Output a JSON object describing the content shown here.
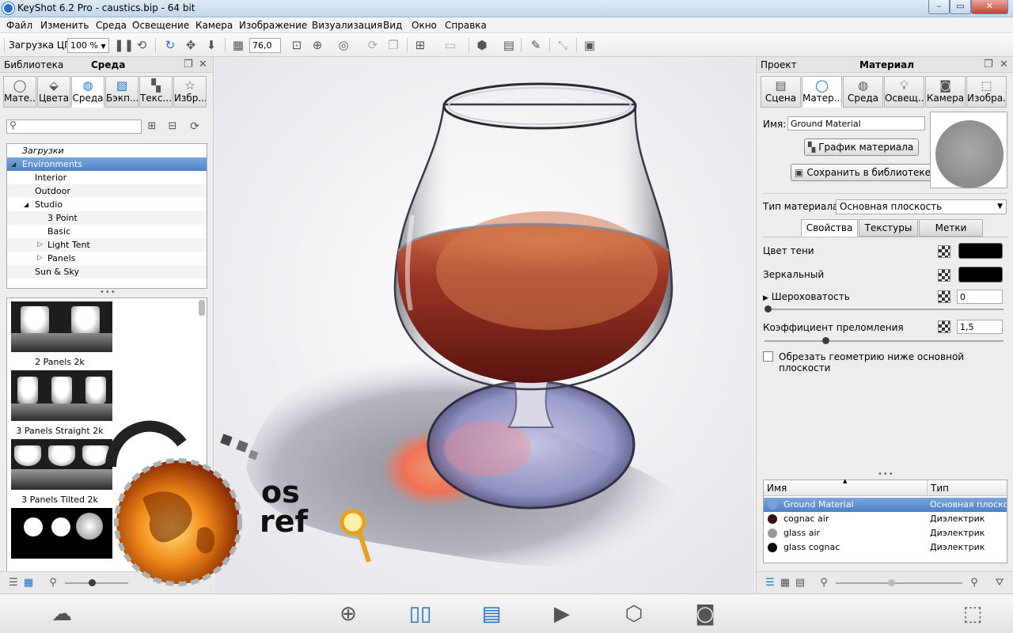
{
  "window": {
    "title": "KeyShot 6.2 Pro  -  caustics.bip  -  64 bit",
    "btn_min": "–",
    "btn_max": "▭",
    "btn_close": "✕"
  },
  "menu": [
    "Файл",
    "Изменить",
    "Среда",
    "Освещение",
    "Камера",
    "Изображение",
    "Визуализация",
    "Вид",
    "Окно",
    "Справка"
  ],
  "toolbar": {
    "cpu_label": "Загрузка ЦП",
    "cpu_value": "100 %",
    "fov_value": "76,0"
  },
  "library": {
    "title": "Библиотека",
    "subtitle": "Среда",
    "tabs": [
      "Мате...",
      "Цвета",
      "Среда",
      "Бэкп...",
      "Текс...",
      "Избр..."
    ],
    "active_tab": 2,
    "search_placeholder": "",
    "tree": [
      {
        "label": "Загрузки",
        "expander": ""
      },
      {
        "label": "Environments",
        "expander": "◢"
      },
      {
        "label": "Interior",
        "expander": ""
      },
      {
        "label": "Outdoor",
        "expander": ""
      },
      {
        "label": "Studio",
        "expander": "◢"
      },
      {
        "label": "3 Point",
        "expander": ""
      },
      {
        "label": "Basic",
        "expander": ""
      },
      {
        "label": "Light Tent",
        "expander": "▷"
      },
      {
        "label": "Panels",
        "expander": "▷"
      },
      {
        "label": "Sun & Sky",
        "expander": ""
      }
    ],
    "thumbnails": [
      "2 Panels 2k",
      "3 Panels Straight 2k",
      "3 Panels Tilted 2k",
      ""
    ]
  },
  "project": {
    "title": "Проект",
    "subtitle": "Материал",
    "tabs": [
      "Сцена",
      "Матер...",
      "Среда",
      "Освещ...",
      "Камера",
      "Изобра..."
    ],
    "active_tab": 1,
    "name_label": "Имя:",
    "name_value": "Ground Material",
    "graph_button": "График материала",
    "save_button": "Сохранить в библиотеке",
    "type_label": "Тип материала:",
    "type_value": "Основная плоскость",
    "subtabs": [
      "Свойства",
      "Текстуры",
      "Метки"
    ],
    "active_subtab": 0,
    "props": {
      "shadow_color": "Цвет тени",
      "specular": "Зеркальный",
      "roughness": "Шероховатость",
      "roughness_value": "0",
      "ior": "Коэффициент преломления",
      "ior_value": "1,5",
      "clip": "Обрезать геометрию ниже основной плоскости"
    },
    "table": {
      "col_name": "Имя",
      "col_type": "Тип",
      "rows": [
        {
          "name": "Ground Material",
          "type": "Основная плоско",
          "color": "#7f9fce"
        },
        {
          "name": "cognac air",
          "type": "Диэлектрик",
          "color": "#3a1010"
        },
        {
          "name": "glass air",
          "type": "Диэлектрик",
          "color": "#9a9a9a"
        },
        {
          "name": "glass cognac",
          "type": "Диэлектрик",
          "color": "#0a0a0a"
        }
      ]
    }
  },
  "watermark": {
    "line1": "os",
    "line2": "ref"
  },
  "colors": {
    "accent": "#1f6fc5",
    "selection": "#5a8ccc",
    "cognac": "#7a1d14"
  }
}
